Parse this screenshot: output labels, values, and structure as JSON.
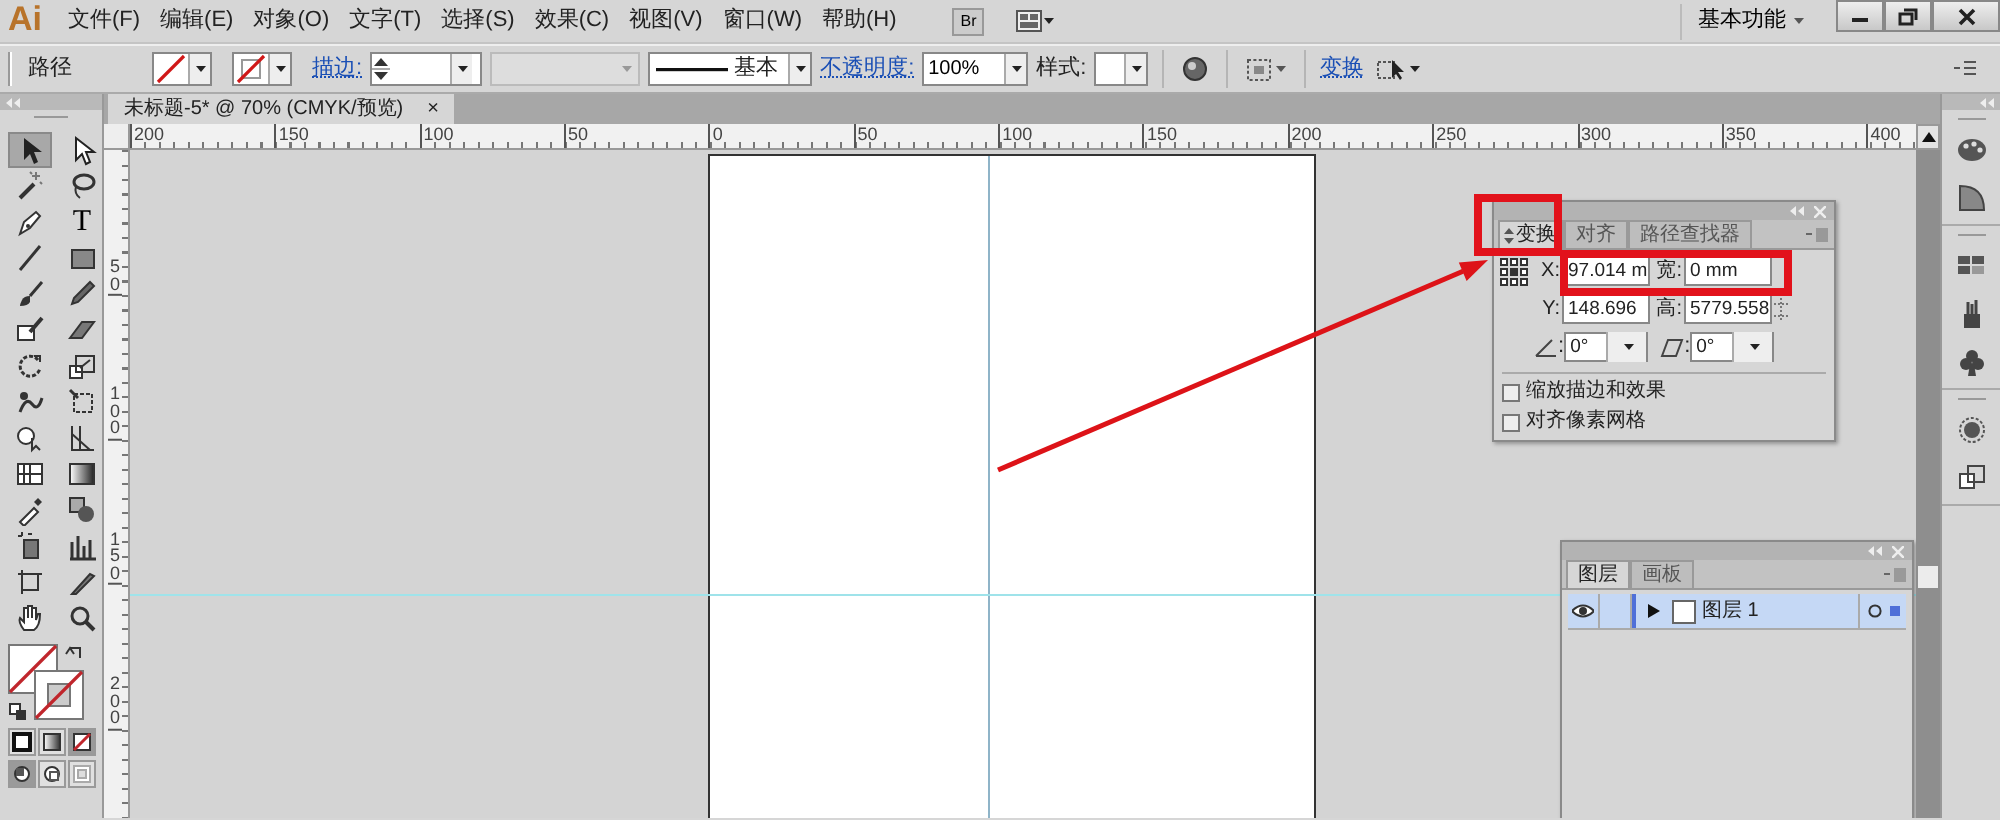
{
  "app_logo": "Ai",
  "menu": [
    "文件(F)",
    "编辑(E)",
    "对象(O)",
    "文字(T)",
    "选择(S)",
    "效果(C)",
    "视图(V)",
    "窗口(W)",
    "帮助(H)"
  ],
  "bridge_button": "Br",
  "workspace": "基本功能",
  "control_bar": {
    "selection_label": "路径",
    "stroke_link": "描边:",
    "stroke_profile": "基本",
    "opacity_link": "不透明度:",
    "opacity_value": "100%",
    "style_label": "样式:",
    "transform_link": "变换"
  },
  "document_tab": {
    "title": "未标题-5* @ 70% (CMYK/预览)",
    "close": "×"
  },
  "ruler": {
    "horizontal": [
      "200",
      "150",
      "100",
      "50",
      "0",
      "50",
      "100",
      "150",
      "200",
      "250",
      "300",
      "350",
      "400"
    ],
    "vertical": [
      "50",
      "100",
      "150",
      "200"
    ]
  },
  "tools": [
    {
      "selected": true
    },
    {
      "selected": false
    },
    {
      "selected": false
    },
    {
      "selected": false
    },
    {
      "selected": false
    },
    {
      "selected": false,
      "glyph": "T"
    },
    {
      "selected": false
    },
    {
      "selected": false
    },
    {
      "selected": false
    },
    {
      "selected": false
    },
    {
      "selected": false
    },
    {
      "selected": false
    },
    {
      "selected": false
    },
    {
      "selected": false
    },
    {
      "selected": false
    },
    {
      "selected": false
    },
    {
      "selected": false
    },
    {
      "selected": false
    },
    {
      "selected": false
    },
    {
      "selected": false
    },
    {
      "selected": false
    },
    {
      "selected": false
    },
    {
      "selected": false
    },
    {
      "selected": false
    },
    {
      "selected": false
    },
    {
      "selected": false
    },
    {
      "selected": false
    },
    {
      "selected": false
    }
  ],
  "color_modes": [
    {
      "selected": false
    },
    {
      "selected": false
    },
    {
      "selected": true
    }
  ],
  "draw_modes": [
    {
      "selected": true
    },
    {
      "selected": false
    },
    {
      "selected": false
    }
  ],
  "transform_panel": {
    "tabs": [
      {
        "label": "变换",
        "selected": true
      },
      {
        "label": "对齐",
        "selected": false
      },
      {
        "label": "路径查找器",
        "selected": false
      }
    ],
    "fields": [
      {
        "label": "X:",
        "value": "97.014 m"
      },
      {
        "label": "宽:",
        "value": "0 mm"
      },
      {
        "label": "Y:",
        "value": "148.696"
      },
      {
        "label": "高:",
        "value": "5779.558"
      }
    ],
    "angle_fields": [
      {
        "separator": ":",
        "value": "0°"
      },
      {
        "separator": ":",
        "value": "0°"
      }
    ],
    "checkboxes": [
      {
        "label": "缩放描边和效果",
        "checked": false
      },
      {
        "label": "对齐像素网格",
        "checked": false
      }
    ]
  },
  "layers_panel": {
    "tabs": [
      {
        "label": "图层",
        "selected": true
      },
      {
        "label": "画板",
        "selected": false
      }
    ],
    "layers": [
      {
        "name": "图层 1",
        "visible": true,
        "expanded": false,
        "selected": true,
        "color": "#4f6fd8"
      }
    ]
  }
}
